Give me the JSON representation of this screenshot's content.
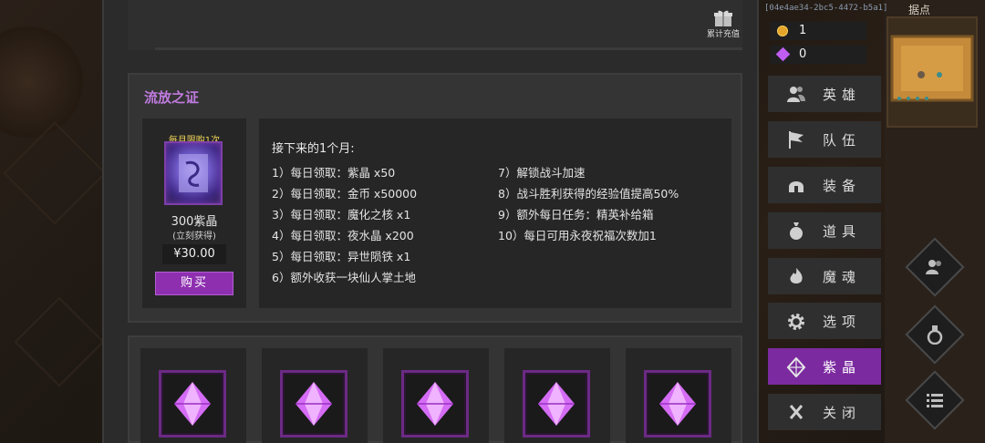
{
  "debug_id": "[04e4ae34-2bc5-4472-b5a1]",
  "map_label": "据点",
  "gift": {
    "label": "累计充值"
  },
  "currency": {
    "gold": "1",
    "crystal": "0"
  },
  "pass_card": {
    "title": "流放之证",
    "limit_badge": "每月限购1次",
    "amount": "300紫晶",
    "amount_sub": "(立刻获得)",
    "price": "¥30.00",
    "buy_label": "购买",
    "intro": "接下来的1个月:",
    "benefits_left": [
      "1）每日领取：紫晶 x50",
      "2）每日领取：金币 x50000",
      "3）每日领取：魔化之核 x1",
      "4）每日领取：夜水晶 x200",
      "5）每日领取：异世陨铁 x1",
      "6）额外收获一块仙人掌土地"
    ],
    "benefits_right": [
      "7）解锁战斗加速",
      "8）战斗胜利获得的经验值提高50%",
      "9）额外每日任务：精英补给箱",
      "10）每日可用永夜祝福次数加1"
    ]
  },
  "menu": [
    {
      "label": "英雄",
      "icon": "heroes-icon"
    },
    {
      "label": "队伍",
      "icon": "flag-icon"
    },
    {
      "label": "装备",
      "icon": "helmet-icon"
    },
    {
      "label": "道具",
      "icon": "bag-icon"
    },
    {
      "label": "魔魂",
      "icon": "flame-icon"
    },
    {
      "label": "选项",
      "icon": "gear-icon"
    },
    {
      "label": "紫晶",
      "icon": "crystal-icon",
      "active": true
    },
    {
      "label": "关闭",
      "icon": "close-icon"
    }
  ],
  "colors": {
    "accent": "#8e2fb0",
    "title": "#c07be0",
    "badge": "#f2d65a"
  }
}
